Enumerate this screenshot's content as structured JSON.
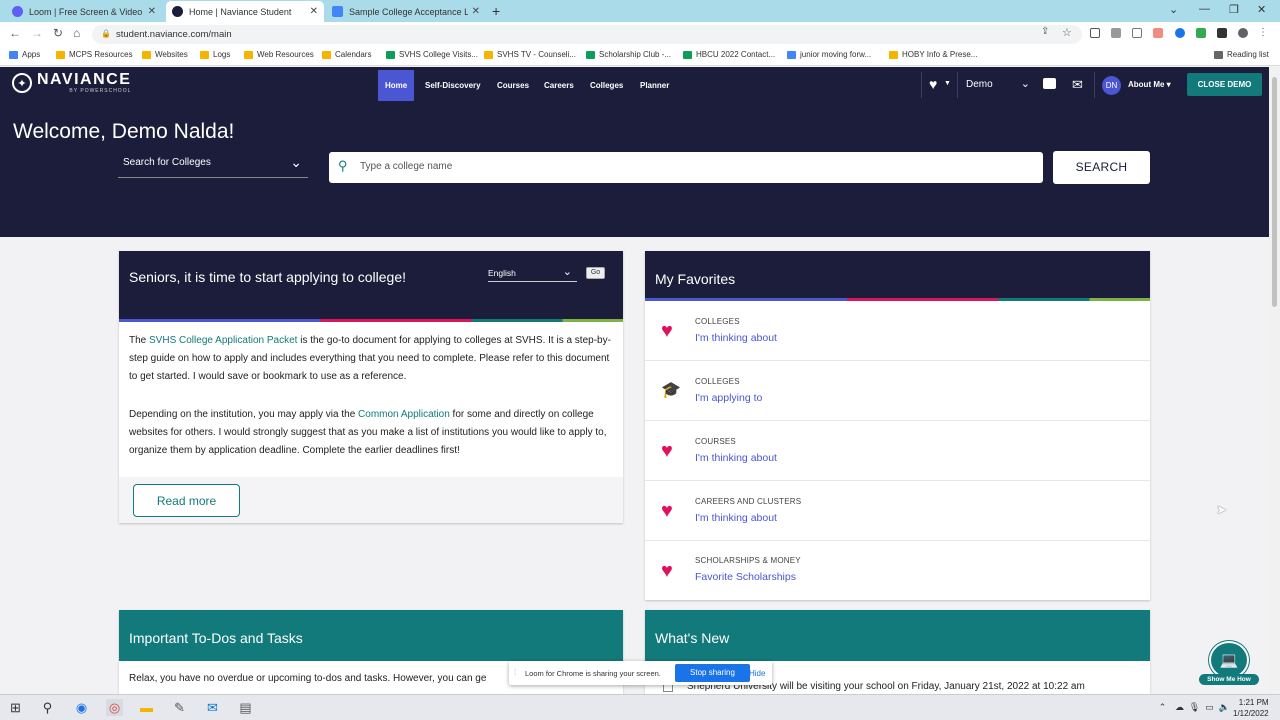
{
  "browser": {
    "tabs": [
      {
        "title": "Loom | Free Screen & Video Rec",
        "active": false,
        "favicon_color": "#625df5"
      },
      {
        "title": "Home | Naviance Student",
        "active": true,
        "favicon_color": "#1b1d3a"
      },
      {
        "title": "Sample College Acceptance Lett",
        "active": false,
        "favicon_color": "#4285f4"
      }
    ],
    "url": "student.naviance.com/main",
    "bookmarks": [
      {
        "label": "Apps",
        "color": "#4285f4"
      },
      {
        "label": "MCPS Resources",
        "color": "#f4b400"
      },
      {
        "label": "Websites",
        "color": "#f4b400"
      },
      {
        "label": "Logs",
        "color": "#f4b400"
      },
      {
        "label": "Web Resources",
        "color": "#f4b400"
      },
      {
        "label": "Calendars",
        "color": "#f4b400"
      },
      {
        "label": "SVHS College Visits...",
        "color": "#0f9d58"
      },
      {
        "label": "SVHS TV - Counseli...",
        "color": "#f4b400"
      },
      {
        "label": "Scholarship Club -...",
        "color": "#0f9d58"
      },
      {
        "label": "HBCU 2022 Contact...",
        "color": "#0f9d58"
      },
      {
        "label": "junior moving forw...",
        "color": "#4285f4"
      },
      {
        "label": "HOBY Info & Prese...",
        "color": "#f4b400"
      }
    ],
    "reading_list": "Reading list"
  },
  "header": {
    "logo_name": "NAVIANCE",
    "logo_sub": "BY POWERSCHOOL",
    "nav": [
      "Home",
      "Self-Discovery",
      "Courses",
      "Careers",
      "Colleges",
      "Planner"
    ],
    "demo_label": "Demo",
    "avatar_initials": "DN",
    "about_me": "About Me ▾",
    "close_demo": "CLOSE DEMO",
    "welcome": "Welcome, Demo Nalda!",
    "search_type": "Search for Colleges",
    "search_placeholder": "Type a college name",
    "search_button": "SEARCH"
  },
  "announcement": {
    "title": "Seniors, it is time to start applying to college!",
    "language": "English",
    "go": "Go",
    "p1_pre": "The ",
    "p1_link": "SVHS College Application Packet",
    "p1_post": " is the go-to document for applying to colleges at SVHS.  It is a step-by-step guide on how to apply and includes everything that you need to complete.  Please refer to this document to get started.  I would save or bookmark to use as a reference.",
    "p2_pre": "Depending on the institution, you may apply via the ",
    "p2_link": "Common Application",
    "p2_post": " for some and directly on college websites for others.  I would strongly suggest that as you make a list of institutions you would like to apply to, organize them by application deadline.  Complete the earlier deadlines first!",
    "read_more": "Read more"
  },
  "favorites": {
    "title": "My Favorites",
    "items": [
      {
        "category": "COLLEGES",
        "link": "I'm thinking about",
        "icon": "heart-icon"
      },
      {
        "category": "COLLEGES",
        "link": "I'm applying to",
        "icon": "graduation-cap-icon"
      },
      {
        "category": "COURSES",
        "link": "I'm thinking about",
        "icon": "heart-icon"
      },
      {
        "category": "CAREERS AND CLUSTERS",
        "link": "I'm thinking about",
        "icon": "heart-icon"
      },
      {
        "category": "SCHOLARSHIPS & MONEY",
        "link": "Favorite Scholarships",
        "icon": "heart-icon"
      }
    ]
  },
  "todos": {
    "title": "Important To-Dos and Tasks",
    "text": "Relax, you have no overdue or upcoming to-dos and tasks. However, you can ge"
  },
  "whats_new": {
    "title": "What's New",
    "text": "Shepherd University will be visiting your school on Friday, January 21st, 2022 at 10:22 am"
  },
  "loom_banner": {
    "text": "Loom for Chrome is sharing your screen.",
    "stop": "Stop sharing",
    "hide": "Hide"
  },
  "show_me": "Show Me How",
  "taskbar": {
    "time": "1:21 PM",
    "date": "1/12/2022"
  },
  "colors": {
    "navy": "#1b1d3a",
    "teal": "#127a7a",
    "accent": "#4b56d2",
    "pink": "#e0115f"
  }
}
